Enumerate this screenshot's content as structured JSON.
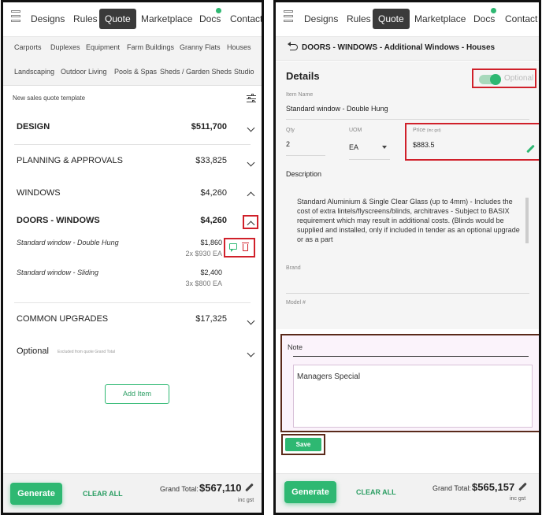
{
  "nav": {
    "items": [
      "Designs",
      "Rules",
      "Quote",
      "Marketplace",
      "Docs",
      "Contact"
    ],
    "active": "Quote"
  },
  "left": {
    "categories": [
      "Carports",
      "Duplexes",
      "Equipment",
      "Farm Buildings",
      "Granny Flats",
      "Houses",
      "Landscaping",
      "Outdoor Living",
      "Pools & Spas",
      "Sheds / Garden Sheds",
      "Studio"
    ],
    "template_label": "New sales quote template",
    "sections": [
      {
        "label": "DESIGN",
        "value": "$511,700"
      },
      {
        "label": "PLANNING & APPROVALS",
        "value": "$33,825"
      },
      {
        "label": "WINDOWS",
        "value": "$4,260"
      },
      {
        "label": "DOORS - WINDOWS",
        "value": "$4,260"
      }
    ],
    "items": [
      {
        "name": "Standard window - Double Hung",
        "price": "$1,860",
        "sub": "2x $930 EA"
      },
      {
        "name": "Standard window - Sliding",
        "price": "$2,400",
        "sub": "3x $800 EA"
      }
    ],
    "common_upgrades": {
      "label": "COMMON UPGRADES",
      "value": "$17,325"
    },
    "optional": {
      "label": "Optional",
      "note": "Excluded from quote Grand Total"
    },
    "add_item": "Add Item",
    "footer": {
      "generate": "Generate",
      "clear_all": "CLEAR ALL",
      "grand_total_label": "Grand Total:",
      "grand_total": "$567,110",
      "inc_gst": "inc gst"
    }
  },
  "right": {
    "title": "DOORS - WINDOWS - Additional Windows - Houses",
    "details": "Details",
    "optional_label": "Optional",
    "item_name_label": "Item Name",
    "item_name": "Standard window - Double Hung",
    "qty_label": "Qty",
    "qty": "2",
    "uom_label": "UOM",
    "uom": "EA",
    "price_label": "Price",
    "price_note": "(inc gst)",
    "price": "$883.5",
    "description_label": "Description",
    "description": "Standard Aluminium & Single Clear Glass (up to 4mm) - Includes the cost of extra lintels/flyscreens/blinds, architraves - Subject to BASIX requirement which may result in additional costs. (Blinds would be supplied and installed, only if included in tender as an optional upgrade or as a part",
    "brand_label": "Brand",
    "model_label": "Model #",
    "note_label": "Note",
    "note_value": "Managers Special",
    "save": "Save",
    "footer": {
      "generate": "Generate",
      "clear_all": "CLEAR ALL",
      "grand_total_label": "Grand Total:",
      "grand_total": "$565,157",
      "inc_gst": "inc gst"
    }
  },
  "colors": {
    "accent": "#2eb872",
    "highlight": "#d0202a",
    "nav_active": "#3a3a3a"
  }
}
